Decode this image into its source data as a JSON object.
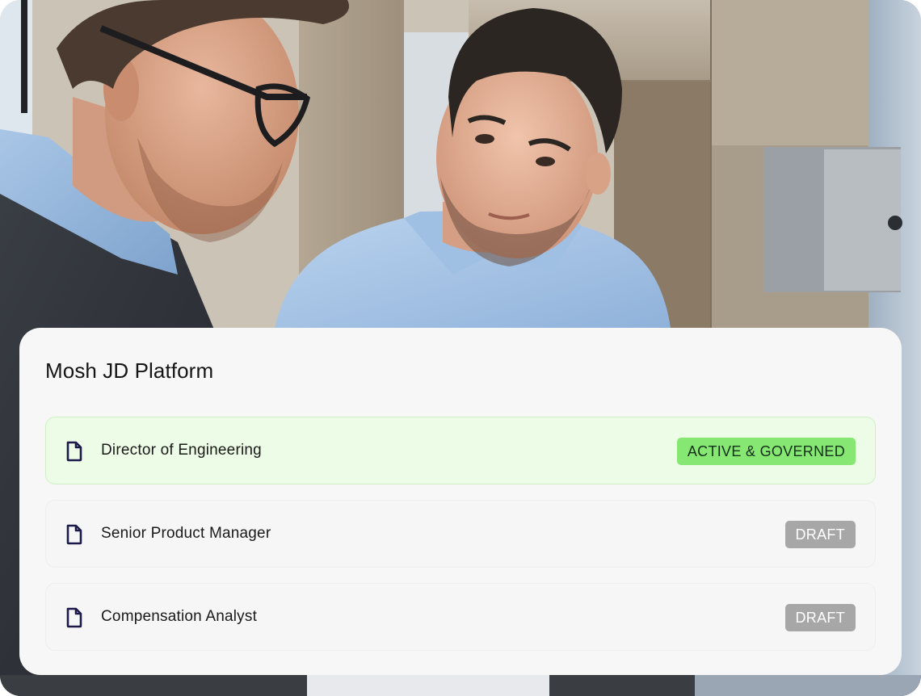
{
  "card": {
    "title": "Mosh JD Platform"
  },
  "rows": [
    {
      "label": "Director of Engineering",
      "status": "ACTIVE & GOVERNED",
      "icon": "document-icon"
    },
    {
      "label": "Senior Product Manager",
      "status": "DRAFT",
      "icon": "document-icon"
    },
    {
      "label": "Compensation Analyst",
      "status": "DRAFT",
      "icon": "document-icon"
    }
  ],
  "colors": {
    "active_badge": "#86e872",
    "draft_badge": "#a7a7a7",
    "active_row_bg": "#ecfce6",
    "icon": "#1c1a4a"
  }
}
